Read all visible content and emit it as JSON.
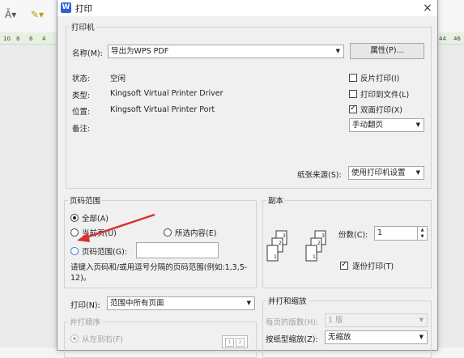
{
  "background": {
    "ruler_numbers": [
      "10",
      "8",
      "6",
      "4"
    ],
    "ruler_numbers_right": [
      "44",
      "46"
    ]
  },
  "dialog": {
    "title": "打印",
    "close": "×",
    "printer": {
      "legend": "打印机",
      "name_label": "名称(M):",
      "name_value": "导出为WPS PDF",
      "properties_button": "属性(P)...",
      "status_label": "状态:",
      "status_value": "空闲",
      "type_label": "类型:",
      "type_value": "Kingsoft Virtual Printer Driver",
      "location_label": "位置:",
      "location_value": "Kingsoft Virtual Printer Port",
      "comment_label": "备注:",
      "reverse_print": {
        "label": "反片打印(I)",
        "checked": false
      },
      "print_to_file": {
        "label": "打印到文件(L)",
        "checked": false
      },
      "duplex": {
        "label": "双面打印(X)",
        "checked": true
      },
      "duplex_mode": "手动翻页",
      "paper_source_label": "纸张来源(S):",
      "paper_source_value": "使用打印机设置"
    },
    "page_range": {
      "legend": "页码范围",
      "all": "全部(A)",
      "current_page": "当前页(U)",
      "selection": "所选内容(E)",
      "page_range_option": "页码范围(G):",
      "page_range_value": "",
      "hint": "请键入页码和/或用逗号分隔的页码范围(例如:1,3,5-12)。"
    },
    "copies": {
      "legend": "副本",
      "count_label": "份数(C):",
      "count_value": "1",
      "collate": {
        "label": "逐份打印(T)",
        "checked": true
      }
    },
    "print_what_label": "打印(N):",
    "print_what_value": "范围中所有页面",
    "order": {
      "legend": "并打顺序",
      "left_to_right": "从左到右(F)"
    },
    "scale": {
      "legend": "并打和缩放",
      "pages_per_sheet_label": "每页的版数(H):",
      "pages_per_sheet_value": "1 版",
      "scale_paper_label": "按纸型缩放(Z):",
      "scale_paper_value": "无缩放"
    }
  },
  "colors": {
    "accent": "#2b63d9",
    "arrow": "#d83030"
  }
}
